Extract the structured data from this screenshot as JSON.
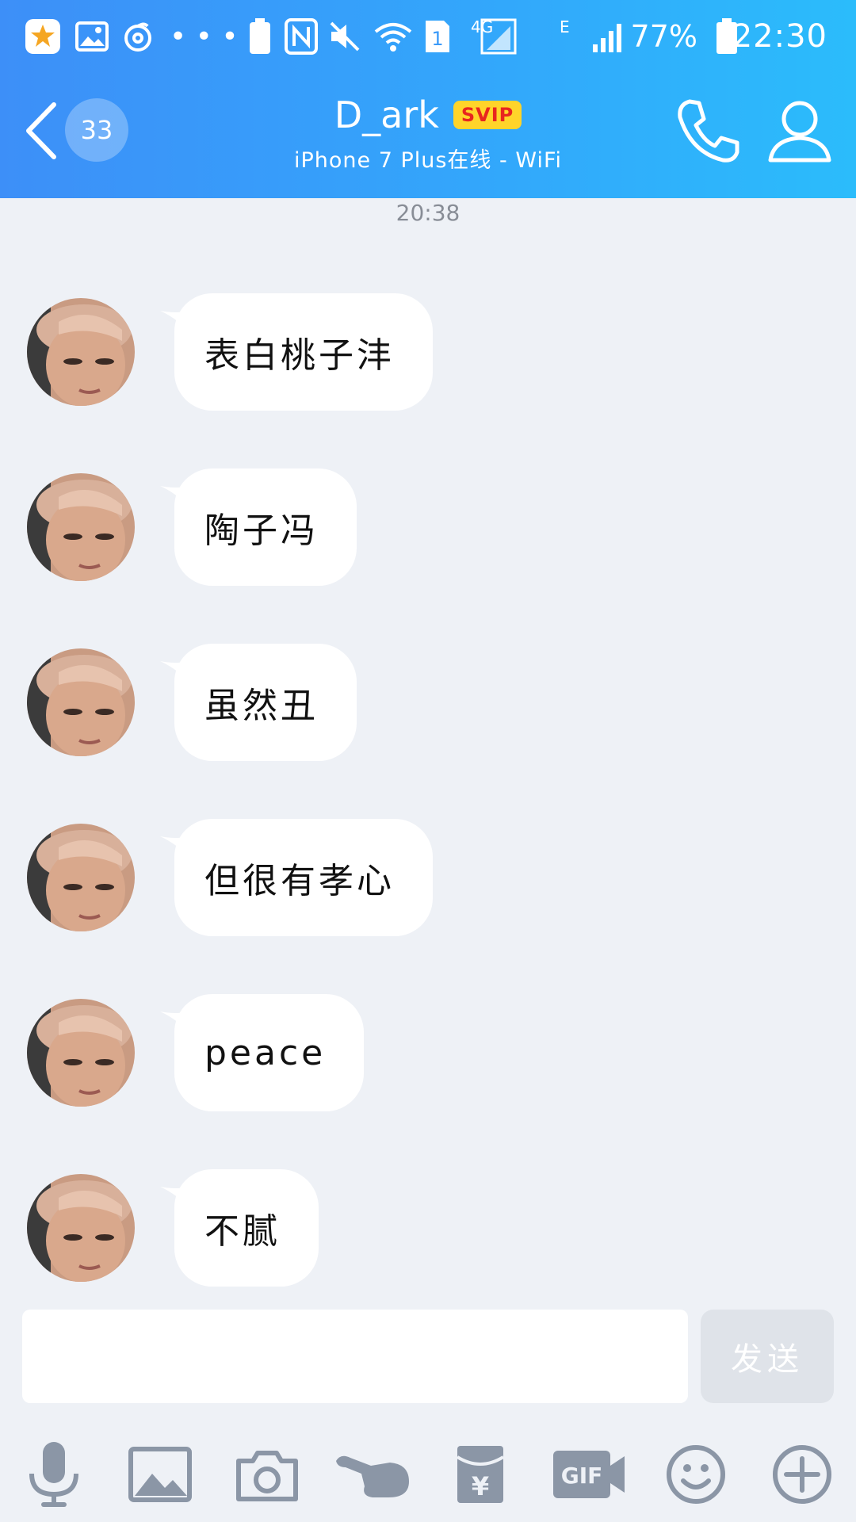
{
  "status_bar": {
    "battery": "77%",
    "time": "22:30",
    "sim_slot": "1",
    "network": "4G",
    "network2": "E"
  },
  "header": {
    "unread_count": "33",
    "title": "D_ark",
    "badge": "SVIP",
    "subtitle": "iPhone 7 Plus在线 - WiFi"
  },
  "chat": {
    "timestamp": "20:38",
    "messages": [
      {
        "text": "表白桃子沣"
      },
      {
        "text": "陶子冯"
      },
      {
        "text": "虽然丑"
      },
      {
        "text": "但很有孝心"
      },
      {
        "text": "peace"
      },
      {
        "text": "不腻"
      }
    ]
  },
  "input": {
    "value": "",
    "send_label": "发送"
  },
  "toolbar": {
    "icons": [
      "microphone-icon",
      "image-icon",
      "camera-icon",
      "poke-icon",
      "red-packet-icon",
      "gif-icon",
      "emoji-icon",
      "plus-icon"
    ],
    "gif_label": "GIF",
    "red_packet_label": "¥"
  },
  "colors": {
    "header_start": "#3d8ff8",
    "header_end": "#2bbcfb",
    "badge_bg": "#ffd42a",
    "badge_text": "#e8261f",
    "chat_bg": "#eef1f6",
    "toolbar_icon": "#8b96a6"
  }
}
